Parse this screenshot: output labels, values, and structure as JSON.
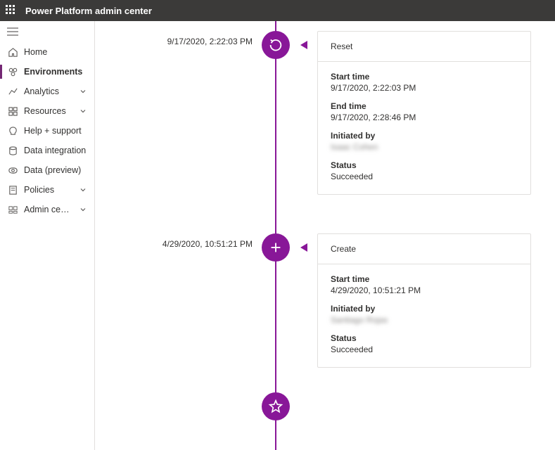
{
  "topbar": {
    "title": "Power Platform admin center"
  },
  "sidebar": {
    "items": [
      {
        "label": "Home",
        "icon": "home",
        "active": false,
        "expandable": false
      },
      {
        "label": "Environments",
        "icon": "environments",
        "active": true,
        "expandable": false
      },
      {
        "label": "Analytics",
        "icon": "analytics",
        "active": false,
        "expandable": true
      },
      {
        "label": "Resources",
        "icon": "resources",
        "active": false,
        "expandable": true
      },
      {
        "label": "Help + support",
        "icon": "help",
        "active": false,
        "expandable": false
      },
      {
        "label": "Data integration",
        "icon": "dataintegration",
        "active": false,
        "expandable": false
      },
      {
        "label": "Data (preview)",
        "icon": "data",
        "active": false,
        "expandable": false
      },
      {
        "label": "Policies",
        "icon": "policies",
        "active": false,
        "expandable": true
      },
      {
        "label": "Admin centers",
        "icon": "admin",
        "active": false,
        "expandable": true
      }
    ]
  },
  "timeline": {
    "events": [
      {
        "time": "9/17/2020, 2:22:03 PM",
        "icon": "reset",
        "title": "Reset",
        "fields": {
          "start_label": "Start time",
          "start_value": "9/17/2020, 2:22:03 PM",
          "end_label": "End time",
          "end_value": "9/17/2020, 2:28:46 PM",
          "initiated_label": "Initiated by",
          "initiated_value": "Isaac Cohen",
          "status_label": "Status",
          "status_value": "Succeeded"
        }
      },
      {
        "time": "4/29/2020, 10:51:21 PM",
        "icon": "create",
        "title": "Create",
        "fields": {
          "start_label": "Start time",
          "start_value": "4/29/2020, 10:51:21 PM",
          "initiated_label": "Initiated by",
          "initiated_value": "Santiago Rojas",
          "status_label": "Status",
          "status_value": "Succeeded"
        }
      }
    ]
  }
}
